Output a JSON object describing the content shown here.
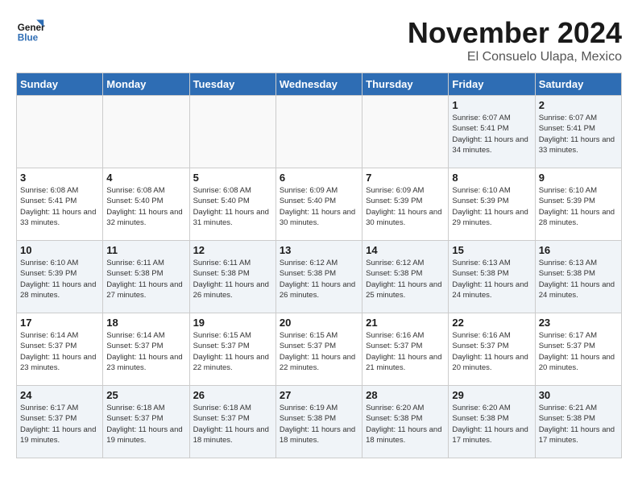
{
  "logo": {
    "line1": "General",
    "line2": "Blue"
  },
  "title": "November 2024",
  "location": "El Consuelo Ulapa, Mexico",
  "days_of_week": [
    "Sunday",
    "Monday",
    "Tuesday",
    "Wednesday",
    "Thursday",
    "Friday",
    "Saturday"
  ],
  "weeks": [
    [
      {
        "day": "",
        "info": ""
      },
      {
        "day": "",
        "info": ""
      },
      {
        "day": "",
        "info": ""
      },
      {
        "day": "",
        "info": ""
      },
      {
        "day": "",
        "info": ""
      },
      {
        "day": "1",
        "info": "Sunrise: 6:07 AM\nSunset: 5:41 PM\nDaylight: 11 hours and 34 minutes."
      },
      {
        "day": "2",
        "info": "Sunrise: 6:07 AM\nSunset: 5:41 PM\nDaylight: 11 hours and 33 minutes."
      }
    ],
    [
      {
        "day": "3",
        "info": "Sunrise: 6:08 AM\nSunset: 5:41 PM\nDaylight: 11 hours and 33 minutes."
      },
      {
        "day": "4",
        "info": "Sunrise: 6:08 AM\nSunset: 5:40 PM\nDaylight: 11 hours and 32 minutes."
      },
      {
        "day": "5",
        "info": "Sunrise: 6:08 AM\nSunset: 5:40 PM\nDaylight: 11 hours and 31 minutes."
      },
      {
        "day": "6",
        "info": "Sunrise: 6:09 AM\nSunset: 5:40 PM\nDaylight: 11 hours and 30 minutes."
      },
      {
        "day": "7",
        "info": "Sunrise: 6:09 AM\nSunset: 5:39 PM\nDaylight: 11 hours and 30 minutes."
      },
      {
        "day": "8",
        "info": "Sunrise: 6:10 AM\nSunset: 5:39 PM\nDaylight: 11 hours and 29 minutes."
      },
      {
        "day": "9",
        "info": "Sunrise: 6:10 AM\nSunset: 5:39 PM\nDaylight: 11 hours and 28 minutes."
      }
    ],
    [
      {
        "day": "10",
        "info": "Sunrise: 6:10 AM\nSunset: 5:39 PM\nDaylight: 11 hours and 28 minutes."
      },
      {
        "day": "11",
        "info": "Sunrise: 6:11 AM\nSunset: 5:38 PM\nDaylight: 11 hours and 27 minutes."
      },
      {
        "day": "12",
        "info": "Sunrise: 6:11 AM\nSunset: 5:38 PM\nDaylight: 11 hours and 26 minutes."
      },
      {
        "day": "13",
        "info": "Sunrise: 6:12 AM\nSunset: 5:38 PM\nDaylight: 11 hours and 26 minutes."
      },
      {
        "day": "14",
        "info": "Sunrise: 6:12 AM\nSunset: 5:38 PM\nDaylight: 11 hours and 25 minutes."
      },
      {
        "day": "15",
        "info": "Sunrise: 6:13 AM\nSunset: 5:38 PM\nDaylight: 11 hours and 24 minutes."
      },
      {
        "day": "16",
        "info": "Sunrise: 6:13 AM\nSunset: 5:38 PM\nDaylight: 11 hours and 24 minutes."
      }
    ],
    [
      {
        "day": "17",
        "info": "Sunrise: 6:14 AM\nSunset: 5:37 PM\nDaylight: 11 hours and 23 minutes."
      },
      {
        "day": "18",
        "info": "Sunrise: 6:14 AM\nSunset: 5:37 PM\nDaylight: 11 hours and 23 minutes."
      },
      {
        "day": "19",
        "info": "Sunrise: 6:15 AM\nSunset: 5:37 PM\nDaylight: 11 hours and 22 minutes."
      },
      {
        "day": "20",
        "info": "Sunrise: 6:15 AM\nSunset: 5:37 PM\nDaylight: 11 hours and 22 minutes."
      },
      {
        "day": "21",
        "info": "Sunrise: 6:16 AM\nSunset: 5:37 PM\nDaylight: 11 hours and 21 minutes."
      },
      {
        "day": "22",
        "info": "Sunrise: 6:16 AM\nSunset: 5:37 PM\nDaylight: 11 hours and 20 minutes."
      },
      {
        "day": "23",
        "info": "Sunrise: 6:17 AM\nSunset: 5:37 PM\nDaylight: 11 hours and 20 minutes."
      }
    ],
    [
      {
        "day": "24",
        "info": "Sunrise: 6:17 AM\nSunset: 5:37 PM\nDaylight: 11 hours and 19 minutes."
      },
      {
        "day": "25",
        "info": "Sunrise: 6:18 AM\nSunset: 5:37 PM\nDaylight: 11 hours and 19 minutes."
      },
      {
        "day": "26",
        "info": "Sunrise: 6:18 AM\nSunset: 5:37 PM\nDaylight: 11 hours and 18 minutes."
      },
      {
        "day": "27",
        "info": "Sunrise: 6:19 AM\nSunset: 5:38 PM\nDaylight: 11 hours and 18 minutes."
      },
      {
        "day": "28",
        "info": "Sunrise: 6:20 AM\nSunset: 5:38 PM\nDaylight: 11 hours and 18 minutes."
      },
      {
        "day": "29",
        "info": "Sunrise: 6:20 AM\nSunset: 5:38 PM\nDaylight: 11 hours and 17 minutes."
      },
      {
        "day": "30",
        "info": "Sunrise: 6:21 AM\nSunset: 5:38 PM\nDaylight: 11 hours and 17 minutes."
      }
    ]
  ]
}
